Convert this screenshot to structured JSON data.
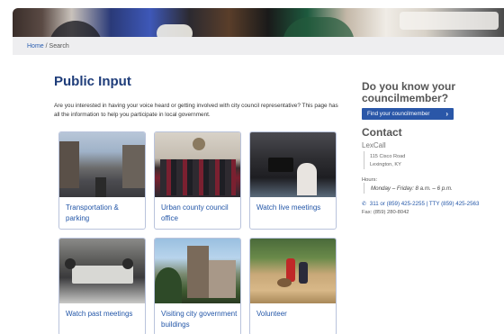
{
  "breadcrumb": {
    "home": "Home",
    "separator": "/",
    "current": "Search"
  },
  "page": {
    "title": "Public Input",
    "intro": "Are you interested in having your voice heard or getting involved with city council representative? This page has all the information to help you participate in local government."
  },
  "cards": [
    {
      "label": "Transportation & parking",
      "image": "downtown street photo"
    },
    {
      "label": "Urban county council office",
      "image": "council members photo"
    },
    {
      "label": "Watch live meetings",
      "image": "camera crew photo"
    },
    {
      "label": "Watch past meetings",
      "image": "meeting room photo"
    },
    {
      "label": "Visiting city government buildings",
      "image": "government building photo"
    },
    {
      "label": "Volunteer",
      "image": "volunteers outdoors photo"
    }
  ],
  "sidebar": {
    "question": "Do you know your councilmember?",
    "find_button": "Find your councilmember",
    "contact_title": "Contact",
    "org": "LexCall",
    "address_line1": "115 Cisco Road",
    "address_line2": "Lexington, KY",
    "hours_label": "Hours:",
    "hours": "Monday – Friday: 8 a.m. – 6 p.m.",
    "phone": "311 or (859) 425-2255 | TTY (859) 425-2563",
    "fax": "Fax: (859) 280-8042"
  },
  "colors": {
    "accent": "#2a57a8",
    "title": "#1f3d7a",
    "link": "#2457a8"
  }
}
